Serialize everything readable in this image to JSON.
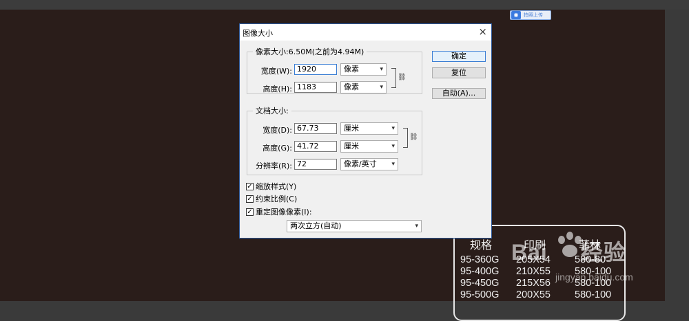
{
  "dialog": {
    "title": "图像大小",
    "close_symbol": "×",
    "pixel_size_legend": "像素大小:6.50M(之前为4.94M)",
    "width_label": "宽度(W):",
    "width_value": "1920",
    "width_unit": "像素",
    "height_label": "高度(H):",
    "height_value": "1183",
    "height_unit": "像素",
    "doc_size_legend": "文档大小:",
    "doc_width_label": "宽度(D):",
    "doc_width_value": "67.73",
    "doc_width_unit": "厘米",
    "doc_height_label": "高度(G):",
    "doc_height_value": "41.72",
    "doc_height_unit": "厘米",
    "resolution_label": "分辨率(R):",
    "resolution_value": "72",
    "resolution_unit": "像素/英寸",
    "ok_label": "确定",
    "reset_label": "复位",
    "auto_label": "自动(A)...",
    "scale_styles_label": "缩放样式(Y)",
    "constrain_label": "约束比例(C)",
    "resample_label": "重定图像像素(I):",
    "resample_method": "两次立方(自动)",
    "chain_icon": "link-icon"
  },
  "toolbar": {
    "upload_label": "拍照上传"
  },
  "canvas_card": {
    "headers": [
      "规格",
      "印刷",
      "菲林"
    ],
    "rows": [
      [
        "95-360G",
        "205X54",
        "580-80"
      ],
      [
        "95-400G",
        "210X55",
        "580-100"
      ],
      [
        "95-450G",
        "215X56",
        "580-100"
      ],
      [
        "95-500G",
        "200X55",
        "580-100"
      ]
    ]
  },
  "watermark": {
    "brand": "Bai",
    "suffix": "经验",
    "sub": "jingyan.baidu.com"
  }
}
